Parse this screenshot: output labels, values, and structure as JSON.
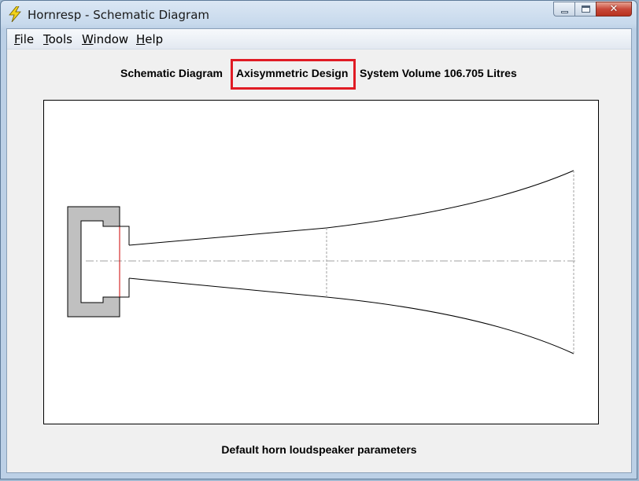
{
  "window": {
    "title": "Hornresp - Schematic Diagram",
    "icon": "lightning-bolt-icon",
    "controls": {
      "minimize": "",
      "maximize": "",
      "close": "✕"
    }
  },
  "menu": [
    {
      "accel": "F",
      "rest": "ile"
    },
    {
      "accel": "T",
      "rest": "ools"
    },
    {
      "accel": "W",
      "rest": "indow"
    },
    {
      "accel": "H",
      "rest": "elp"
    }
  ],
  "header": {
    "view_label": "Schematic Diagram",
    "design_type": "Axisymmetric Design",
    "system_volume": "System Volume 106.705 Litres"
  },
  "diagram": {
    "driver_fill": "#c0c0c0",
    "diaphragm_color": "#cc0000",
    "outline_color": "#000000",
    "guide_color": "#a0a0a0"
  },
  "footer": {
    "status": "Default horn loudspeaker parameters"
  },
  "colors": {
    "highlight": "#e01b24",
    "client_bg": "#f0f0f0"
  }
}
